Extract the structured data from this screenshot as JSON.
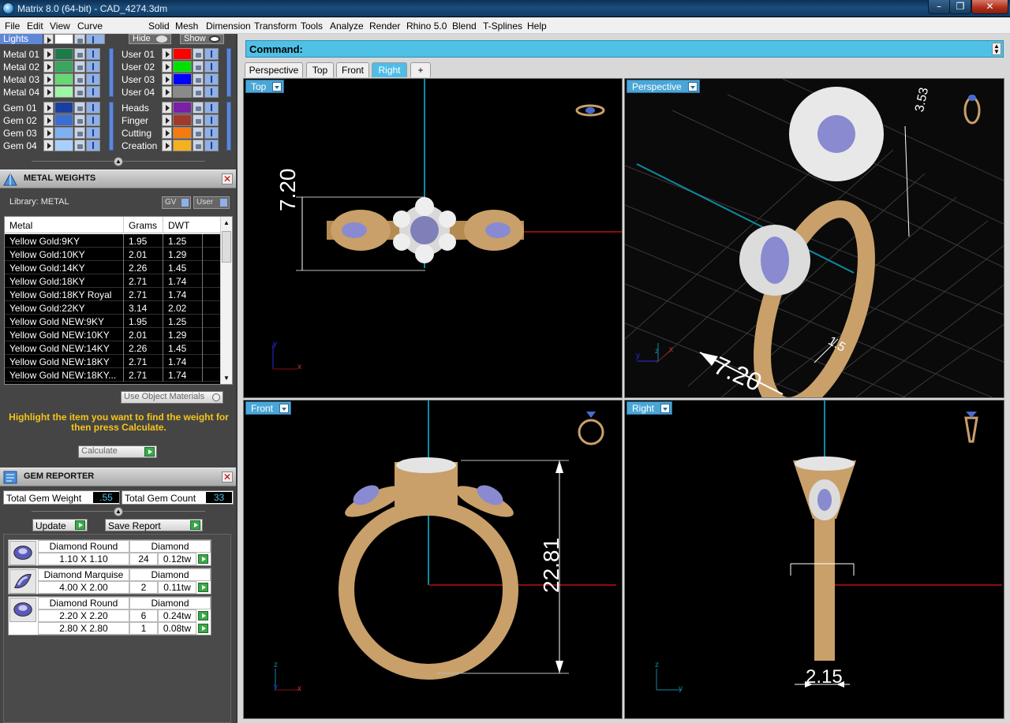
{
  "window": {
    "title": "Matrix 8.0 (64-bit) - CAD_4274.3dm"
  },
  "menu": [
    "File",
    "Edit",
    "View",
    "Curve",
    "Solid",
    "Mesh",
    "Dimension",
    "Transform",
    "Tools",
    "Analyze",
    "Render",
    "Rhino 5.0",
    "Blend",
    "T-Splines",
    "Help"
  ],
  "layers": {
    "lights_label": "Lights",
    "hide_label": "Hide",
    "show_label": "Show",
    "left": [
      {
        "name": "Metal 01",
        "color": "#1f7a4a"
      },
      {
        "name": "Metal 02",
        "color": "#3aa55c"
      },
      {
        "name": "Metal 03",
        "color": "#67d873"
      },
      {
        "name": "Metal 04",
        "color": "#9ff5a6"
      },
      {
        "name": "Gem 01",
        "color": "#1b3fa0"
      },
      {
        "name": "Gem 02",
        "color": "#3a6ed0"
      },
      {
        "name": "Gem 03",
        "color": "#7fb0f0"
      },
      {
        "name": "Gem 04",
        "color": "#a8d0ff"
      }
    ],
    "right": [
      {
        "name": "User 01",
        "color": "#ff0000"
      },
      {
        "name": "User 02",
        "color": "#00e000"
      },
      {
        "name": "User 03",
        "color": "#0000ff"
      },
      {
        "name": "User 04",
        "color": "#8a8a8a"
      },
      {
        "name": "Heads",
        "color": "#7a1fa8"
      },
      {
        "name": "Finger",
        "color": "#a03a2a"
      },
      {
        "name": "Cutting",
        "color": "#f57a10"
      },
      {
        "name": "Creation",
        "color": "#f5b020"
      }
    ]
  },
  "metal_weights": {
    "title": "METAL WEIGHTS",
    "library": "Library: METAL",
    "gv_label": "GV",
    "user_label": "User",
    "headers": {
      "metal": "Metal",
      "grams": "Grams",
      "dwt": "DWT"
    },
    "rows": [
      {
        "metal": "Yellow Gold:9KY",
        "grams": "1.95",
        "dwt": "1.25"
      },
      {
        "metal": "Yellow Gold:10KY",
        "grams": "2.01",
        "dwt": "1.29"
      },
      {
        "metal": "Yellow Gold:14KY",
        "grams": "2.26",
        "dwt": "1.45"
      },
      {
        "metal": "Yellow Gold:18KY",
        "grams": "2.71",
        "dwt": "1.74"
      },
      {
        "metal": "Yellow Gold:18KY Royal",
        "grams": "2.71",
        "dwt": "1.74"
      },
      {
        "metal": "Yellow Gold:22KY",
        "grams": "3.14",
        "dwt": "2.02"
      },
      {
        "metal": "Yellow Gold NEW:9KY",
        "grams": "1.95",
        "dwt": "1.25"
      },
      {
        "metal": "Yellow Gold NEW:10KY",
        "grams": "2.01",
        "dwt": "1.29"
      },
      {
        "metal": "Yellow Gold NEW:14KY",
        "grams": "2.26",
        "dwt": "1.45"
      },
      {
        "metal": "Yellow Gold NEW:18KY",
        "grams": "2.71",
        "dwt": "1.74"
      },
      {
        "metal": "Yellow Gold NEW:18KY...",
        "grams": "2.71",
        "dwt": "1.74"
      }
    ],
    "use_object_materials": "Use Object Materials",
    "hint": "Highlight the item you want to find the weight for then press Calculate.",
    "calculate_label": "Calculate"
  },
  "gem_reporter": {
    "title": "GEM REPORTER",
    "total_weight_label": "Total Gem Weight",
    "total_weight": ".55",
    "total_count_label": "Total Gem Count",
    "total_count": "33",
    "update_label": "Update",
    "save_label": "Save Report",
    "groups": [
      {
        "shape": "Diamond Round",
        "material": "Diamond",
        "sizes": [
          {
            "size": "1.10 X 1.10",
            "count": "24",
            "tw": "0.12tw"
          }
        ]
      },
      {
        "shape": "Diamond Marquise",
        "material": "Diamond",
        "sizes": [
          {
            "size": "4.00 X 2.00",
            "count": "2",
            "tw": "0.11tw"
          }
        ]
      },
      {
        "shape": "Diamond Round",
        "material": "Diamond",
        "sizes": [
          {
            "size": "2.20 X 2.20",
            "count": "6",
            "tw": "0.24tw"
          },
          {
            "size": "2.80 X 2.80",
            "count": "1",
            "tw": "0.08tw"
          }
        ]
      }
    ]
  },
  "command": {
    "label": "Command:"
  },
  "tabs": [
    "Perspective",
    "Top",
    "Front",
    "Right",
    "+"
  ],
  "active_tab": "Right",
  "viewports": {
    "top": {
      "label": "Top",
      "dimension": "7.20",
      "axis_y": "y",
      "axis_x": "x"
    },
    "perspective": {
      "label": "Perspective",
      "dimension_main": "7.20",
      "dimension_side": "1.5",
      "dimension_height": "3.53",
      "axis_y": "y",
      "axis_z": "z",
      "axis_x": "x"
    },
    "front": {
      "label": "Front",
      "dimension": "22.81",
      "axis_z": "z",
      "axis_y": "y",
      "axis_x": "x"
    },
    "right": {
      "label": "Right",
      "dimension": "2.15",
      "axis_z": "z",
      "axis_y": "y"
    }
  }
}
